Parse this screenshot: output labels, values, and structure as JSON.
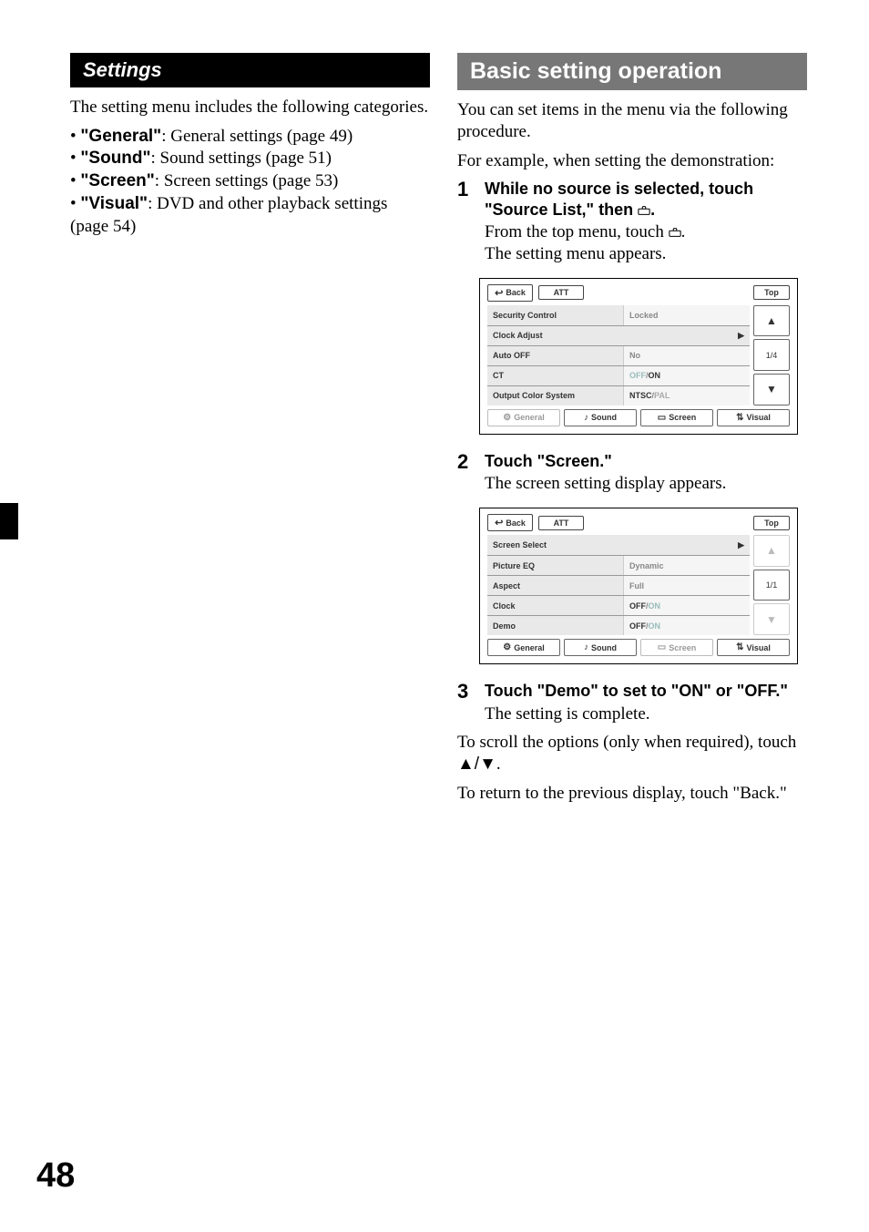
{
  "page_number": "48",
  "left": {
    "header": "Settings",
    "intro": "The setting menu includes the following categories.",
    "bullets": [
      {
        "label": "\"General\"",
        "rest": ": General settings (page 49)"
      },
      {
        "label": "\"Sound\"",
        "rest": ": Sound settings (page 51)"
      },
      {
        "label": "\"Screen\"",
        "rest": ": Screen settings (page 53)"
      },
      {
        "label": "\"Visual\"",
        "rest": ": DVD and other playback settings (page 54)"
      }
    ]
  },
  "right": {
    "header": "Basic setting operation",
    "intro1": "You can set items in the menu via the following procedure.",
    "intro2": "For example, when setting the demonstration:",
    "step1": {
      "num": "1",
      "title_a": "While no source is selected, touch \"Source List,\" then ",
      "title_b": ".",
      "line1": "From the top menu, touch ",
      "line1_end": ".",
      "line2": "The setting menu appears."
    },
    "ui1": {
      "back": "Back",
      "att": "ATT",
      "top": "Top",
      "rows": {
        "security_control": "Security Control",
        "security_value": "Locked",
        "clock_adjust": "Clock Adjust",
        "auto_off": "Auto OFF",
        "auto_off_value": "No",
        "ct": "CT",
        "ct_off": "OFF",
        "ct_on": "ON",
        "ocs": "Output Color System",
        "ocs_ntsc": "NTSC",
        "ocs_pal": "PAL"
      },
      "pager": "1/4",
      "tabs": {
        "general": "General",
        "sound": "Sound",
        "screen": "Screen",
        "visual": "Visual"
      }
    },
    "step2": {
      "num": "2",
      "title": "Touch \"Screen.\"",
      "line1": "The screen setting display appears."
    },
    "ui2": {
      "back": "Back",
      "att": "ATT",
      "top": "Top",
      "rows": {
        "screen_select": "Screen Select",
        "picture_eq": "Picture EQ",
        "picture_eq_value": "Dynamic",
        "aspect": "Aspect",
        "aspect_value": "Full",
        "clock": "Clock",
        "clock_off": "OFF",
        "clock_on": "ON",
        "demo": "Demo",
        "demo_off": "OFF",
        "demo_on": "ON"
      },
      "pager": "1/1",
      "tabs": {
        "general": "General",
        "sound": "Sound",
        "screen": "Screen",
        "visual": "Visual"
      }
    },
    "step3": {
      "num": "3",
      "title": "Touch \"Demo\" to set to \"ON\" or \"OFF.\"",
      "line1": "The setting is complete."
    },
    "footer1a": "To scroll the options (only when required), touch ",
    "footer1b": "▲/▼",
    "footer1c": ".",
    "footer2": "To return to the previous display, touch \"Back.\""
  }
}
